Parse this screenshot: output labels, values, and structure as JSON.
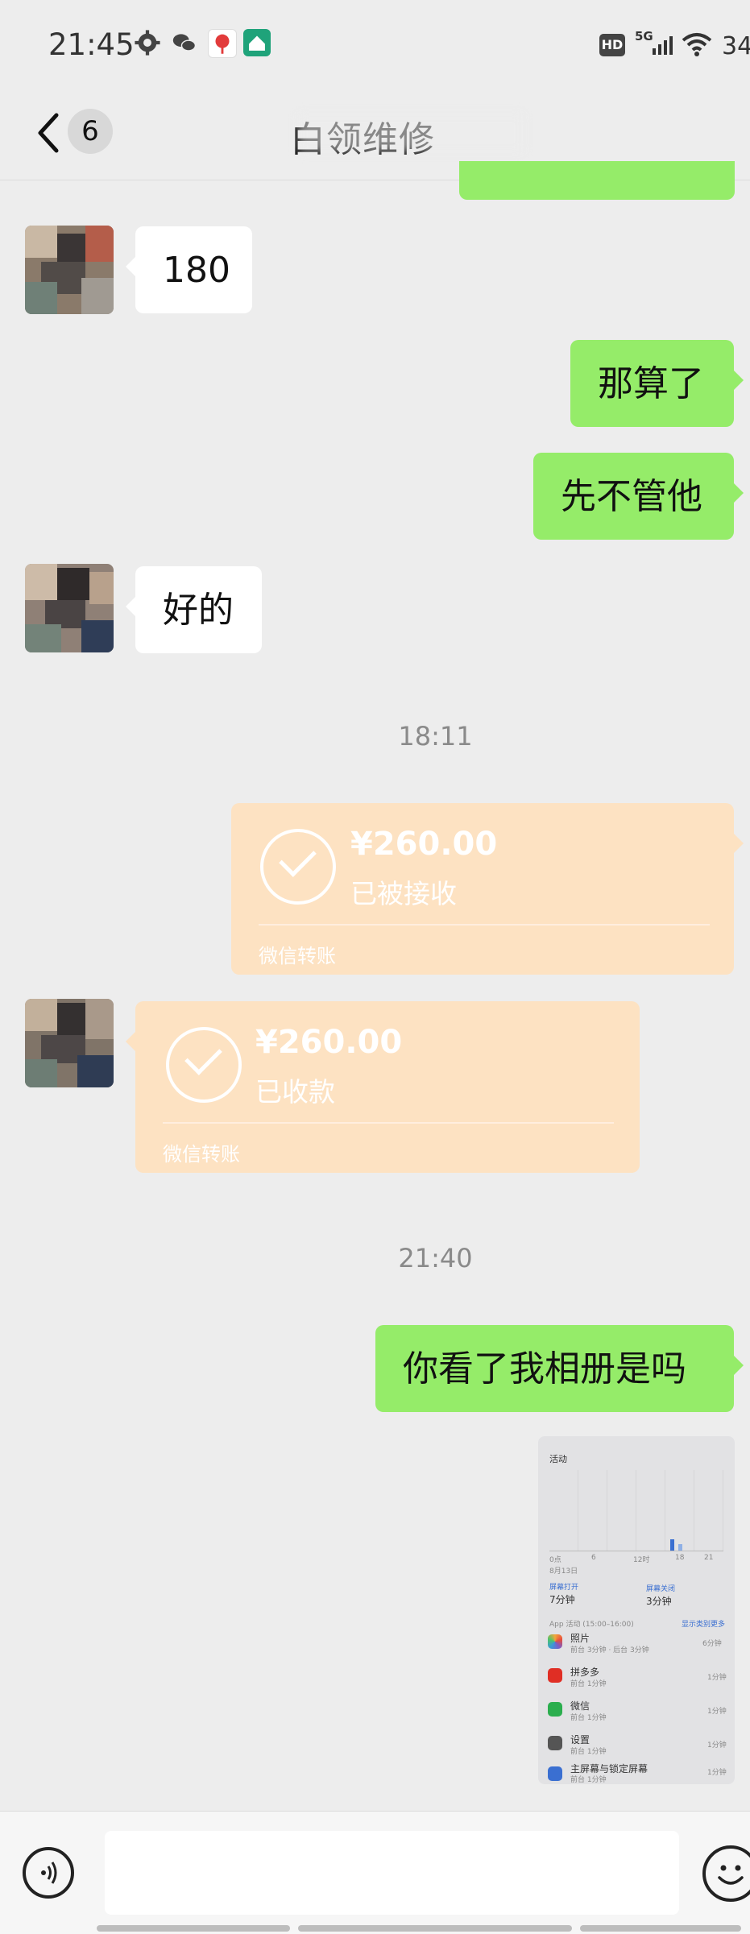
{
  "status_bar": {
    "time": "21:45",
    "network": "5G",
    "hd": "HD",
    "battery": "34",
    "icons": [
      "gear-icon",
      "wechat-icon",
      "app-icon-red",
      "app-icon-green"
    ]
  },
  "header": {
    "unread_count": "6",
    "title": "白领维修"
  },
  "messages": [
    {
      "side": "in",
      "text": "180"
    },
    {
      "side": "out",
      "text": "那算了"
    },
    {
      "side": "out",
      "text": "先不管他"
    },
    {
      "side": "in",
      "text": "好的"
    },
    {
      "type": "time",
      "text": "18:11"
    },
    {
      "side": "out",
      "type": "transfer",
      "amount": "¥260.00",
      "status": "已被接收",
      "brand": "微信转账"
    },
    {
      "side": "in",
      "type": "transfer",
      "amount": "¥260.00",
      "status": "已收款",
      "brand": "微信转账"
    },
    {
      "type": "time",
      "text": "21:40"
    },
    {
      "side": "out",
      "text": "你看了我相册是吗"
    },
    {
      "side": "out",
      "type": "image"
    }
  ],
  "photo": {
    "heading": "活动",
    "chart_x": [
      "0点",
      "6",
      "12时",
      "18",
      "21"
    ],
    "date": "8月13日",
    "screen_on_label": "屏幕打开",
    "screen_on_value": "7分钟",
    "screen_off_label": "屏幕关闭",
    "screen_off_value": "3分钟",
    "apps_header": "App 活动 (15:00–16:00)",
    "show_link": "显示类别更多",
    "apps": [
      {
        "name": "照片",
        "sub": "前台 3分钟 · 后台 3分钟",
        "time": "6分钟",
        "color": "#f4a63a"
      },
      {
        "name": "拼多多",
        "sub": "前台 1分钟",
        "time": "1分钟",
        "color": "#e02e24"
      },
      {
        "name": "微信",
        "sub": "前台 1分钟",
        "time": "1分钟",
        "color": "#2bae4e"
      },
      {
        "name": "设置",
        "sub": "前台 1分钟",
        "time": "1分钟",
        "color": "#555555"
      },
      {
        "name": "主屏幕与锁定屏幕",
        "sub": "前台 1分钟",
        "time": "1分钟",
        "color": "#3a6fd1"
      }
    ]
  },
  "colors": {
    "outgoing_bubble": "#95ec69",
    "incoming_bubble": "#ffffff",
    "transfer_card": "#fde2c2",
    "background": "#ededed"
  }
}
